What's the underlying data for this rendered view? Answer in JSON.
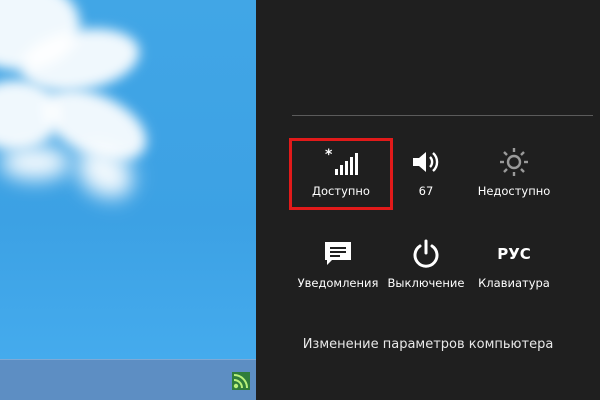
{
  "settings": {
    "tiles": [
      {
        "label": "Доступно",
        "icon": "network-signal-icon"
      },
      {
        "label": "67",
        "icon": "volume-icon"
      },
      {
        "label": "Недоступно",
        "icon": "brightness-icon"
      },
      {
        "label": "Уведомления",
        "icon": "notifications-icon"
      },
      {
        "label": "Выключение",
        "icon": "power-icon"
      },
      {
        "label": "Клавиатура",
        "icon_text": "РУС"
      }
    ],
    "change_pc_settings": "Изменение параметров компьютера"
  },
  "colors": {
    "pane_bg": "#1f1f1f",
    "highlight": "#e11a1a",
    "desktop_bg": "#41a6e6"
  }
}
